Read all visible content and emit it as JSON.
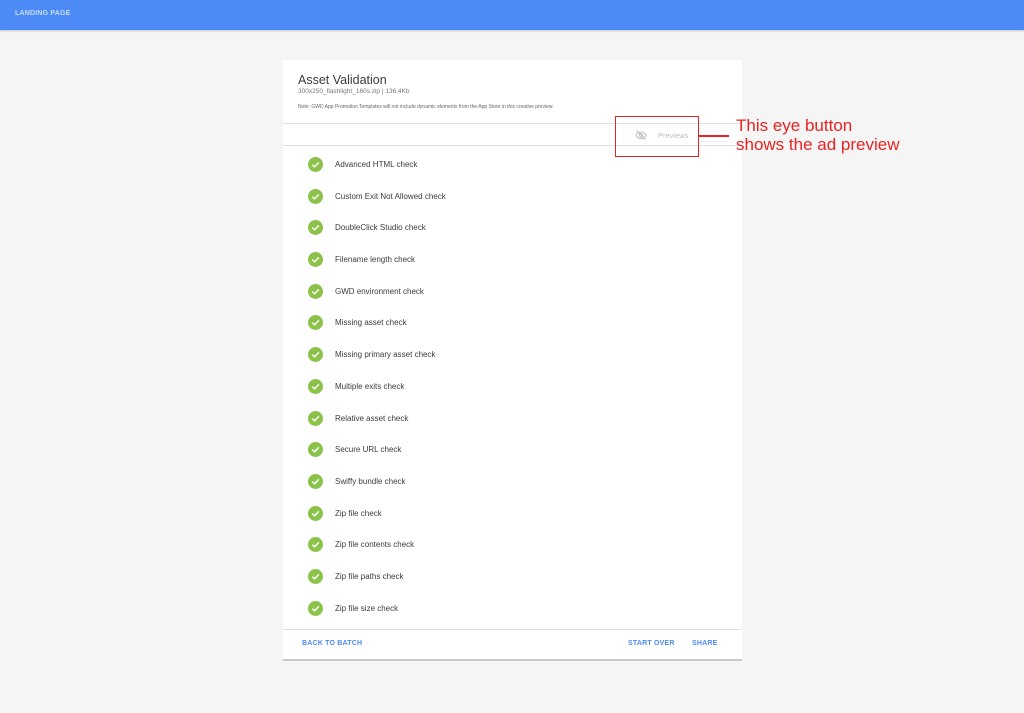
{
  "header": {
    "title": "LANDING PAGE",
    "bar_color": "#4c8bf5"
  },
  "card": {
    "title": "Asset Validation",
    "subtitle": "300x250_flashlight_160s.zip | 136.4Kb",
    "note": "Note: GWD App Promotion Templates will not include dynamic elements from the App Store in this creative preview.",
    "preview_button": {
      "label": "Previews",
      "icon": "eye-off-icon"
    },
    "checks": [
      {
        "label": "Advanced HTML check",
        "status": "passed"
      },
      {
        "label": "Custom Exit Not Allowed check",
        "status": "passed"
      },
      {
        "label": "DoubleClick Studio check",
        "status": "passed"
      },
      {
        "label": "Filename length check",
        "status": "passed"
      },
      {
        "label": "GWD environment check",
        "status": "passed"
      },
      {
        "label": "Missing asset check",
        "status": "passed"
      },
      {
        "label": "Missing primary asset check",
        "status": "passed"
      },
      {
        "label": "Multiple exits check",
        "status": "passed"
      },
      {
        "label": "Relative asset check",
        "status": "passed"
      },
      {
        "label": "Secure URL check",
        "status": "passed"
      },
      {
        "label": "Swiffy bundle check",
        "status": "passed"
      },
      {
        "label": "Zip file check",
        "status": "passed"
      },
      {
        "label": "Zip file contents check",
        "status": "passed"
      },
      {
        "label": "Zip file paths check",
        "status": "passed"
      },
      {
        "label": "Zip file size check",
        "status": "passed"
      }
    ],
    "check_icon": "check-circle-icon",
    "check_color": "#8bc34a",
    "footer": {
      "back_label": "BACK TO BATCH",
      "start_over_label": "START OVER",
      "share_label": "SHARE"
    }
  },
  "annotation": {
    "line1": "This eye button",
    "line2": "shows the ad preview",
    "color": "#e82323"
  }
}
